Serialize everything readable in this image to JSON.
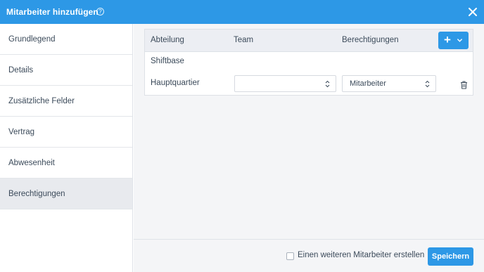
{
  "dialog": {
    "title": "Mitarbeiter hinzufügen",
    "help_icon": "question-circle-icon",
    "close_icon": "close-icon"
  },
  "sidebar": {
    "items": [
      {
        "label": "Grundlegend",
        "active": false
      },
      {
        "label": "Details",
        "active": false
      },
      {
        "label": "Zusätzliche Felder",
        "active": false
      },
      {
        "label": "Vertrag",
        "active": false
      },
      {
        "label": "Abwesenheit",
        "active": false
      },
      {
        "label": "Berechtigungen",
        "active": true
      }
    ]
  },
  "permissions": {
    "headers": {
      "department": "Abteilung",
      "team": "Team",
      "permissions": "Berechtigungen"
    },
    "add_button_icons": [
      "plus-icon",
      "chevron-down-icon"
    ],
    "group_label": "Shiftbase",
    "rows": [
      {
        "department": "Hauptquartier",
        "team_value": "",
        "permission_value": "Mitarbeiter"
      }
    ]
  },
  "footer": {
    "checkbox_label": "Einen weiteren Mitarbeiter erstellen",
    "checkbox_checked": false,
    "save_label": "Speichern"
  },
  "colors": {
    "accent": "#2d98e6",
    "active_sidebar": "#e8eaee",
    "panel_bg": "#f4f5f7"
  }
}
